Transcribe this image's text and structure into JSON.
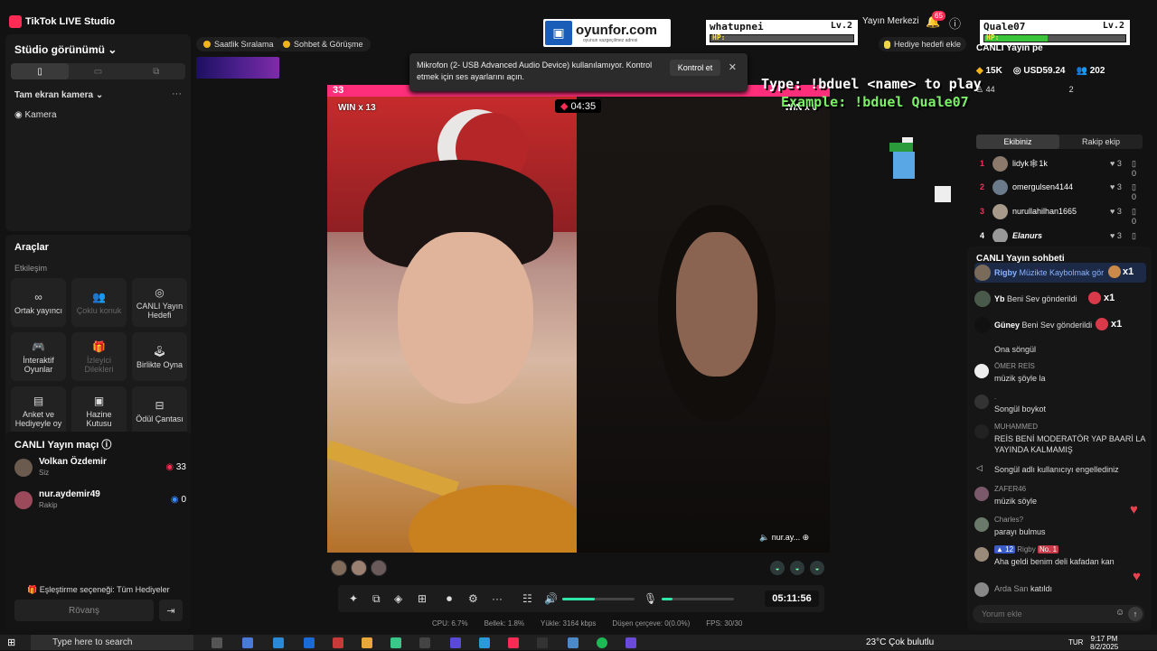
{
  "app": {
    "title": "TikTok LIVE Studio"
  },
  "left": {
    "studio_view_label": "Stüdio görünümü",
    "view_modes": [
      "portrait",
      "landscape",
      "portrait-alt"
    ],
    "scene_label": "Tam ekran kamera",
    "camera_label": "Kamera",
    "tools_title": "Araçlar",
    "interaction_group": "Etkileşim",
    "tools": [
      {
        "label": "Ortak yayıncı",
        "icon": "link-icon",
        "enabled": true
      },
      {
        "label": "Çoklu konuk",
        "icon": "people-icon",
        "enabled": false
      },
      {
        "label": "CANLI Yayın Hedefi",
        "icon": "target-icon",
        "enabled": true
      },
      {
        "label": "İnteraktif Oyunlar",
        "icon": "gamepad-icon",
        "enabled": true
      },
      {
        "label": "İzleyici Dilekleri",
        "icon": "gift-icon",
        "enabled": false
      },
      {
        "label": "Birlikte Oyna",
        "icon": "joystick-icon",
        "enabled": true
      },
      {
        "label": "Anket ve Hediyeyle oy",
        "icon": "poll-icon",
        "enabled": true
      },
      {
        "label": "Hazine Kutusu",
        "icon": "chest-icon",
        "enabled": true
      },
      {
        "label": "Ödül Çantası",
        "icon": "bag-icon",
        "enabled": true
      }
    ],
    "match_title": "CANLI Yayın maçı",
    "match_rows": [
      {
        "name": "Volkan Özdemir",
        "role": "Siz",
        "score": "33"
      },
      {
        "name": "nur.aydemir49",
        "role": "Rakip",
        "score": "0"
      }
    ],
    "pairing_label": "Eşleştirme seçeneği: Tüm Hediyeler",
    "rematch_label": "Rövanş"
  },
  "top_chips": [
    {
      "label": "Saatlik Sıralama"
    },
    {
      "label": "Sohbet & Görüşme"
    }
  ],
  "toast": {
    "message": "Mikrofon (2- USB Advanced Audio Device) kullanılamıyor. Kontrol etmek için ses ayarlarını açın.",
    "action": "Kontrol et"
  },
  "overlay": {
    "brand": "oyunfor.com",
    "brand_sub": "oyunun vazgeçilmez adresi",
    "player1": {
      "name": "whatupnei",
      "level": "Lv.2",
      "hp_label": "HP:",
      "hp": 0.0
    },
    "player2": {
      "name": "Quale07",
      "level": "Lv.2",
      "hp_label": "HP:",
      "hp": 0.45
    },
    "type_line": "Type: !bduel <name> to play",
    "example_line": "Example: !bduel Quale07"
  },
  "stage": {
    "score_left": "33",
    "timer": "04:35",
    "win_left": "WIN x 13",
    "win_right": "WIN x 0",
    "opponent_name": "nur.ay..."
  },
  "controls": {
    "duration": "05:11:56",
    "volume": 0.45,
    "mic_level": 0.15
  },
  "stats": [
    "CPU: 6.7%",
    "Bellek: 1.8%",
    "Yükle: 3164 kbps",
    "Düşen çerçeve: 0(0.0%)",
    "FPS: 30/30"
  ],
  "top_right": {
    "broadcast_center": "Yayın Merkezi",
    "notifications": "65",
    "gift_goal": "Hediye hedefi ekle"
  },
  "right": {
    "live_label": "CANLI Yayın pe",
    "followers": "15K",
    "earnings": "USD59.24",
    "viewers": "202",
    "likes": "44",
    "likes_b": "2",
    "tabs": [
      "Ekibiniz",
      "Rakip ekip"
    ],
    "team": [
      {
        "rank": "1",
        "name": "lidyk🕸1k",
        "likes": "3",
        "comments": "0"
      },
      {
        "rank": "2",
        "name": "omergulsen4144",
        "likes": "3",
        "comments": "0"
      },
      {
        "rank": "3",
        "name": "nurullahilhan1665",
        "likes": "3",
        "comments": "0"
      },
      {
        "rank": "4",
        "name": "Elanurs",
        "likes": "3",
        "comments": "0"
      }
    ],
    "chat_title": "CANLI Yayın sohbeti",
    "gifts": [
      {
        "user": "Rigby",
        "text": "Müzikte Kaybolmak gör",
        "count": "x1"
      },
      {
        "user": "Yb",
        "text": "Beni Sev gönderildi",
        "count": "x1"
      },
      {
        "user": "Güney",
        "text": "Beni Sev gönderildi",
        "count": "x1"
      }
    ],
    "messages": [
      {
        "user": "",
        "text": "Ona söngül"
      },
      {
        "user": "ÖMER REİS",
        "text": "müzik şöyle la"
      },
      {
        "user": ".",
        "text": "Songül boykot"
      },
      {
        "user": "MUHAMMED",
        "text": "REİS BENİ MODERATÖR YAP BAARİ LA YAYINDA KALMAMIŞ"
      },
      {
        "user": "",
        "text": "Songül adlı kullanıcıyı engellediniz"
      },
      {
        "user": "ZAFER46",
        "text": "müzik söyle"
      },
      {
        "user": "Charles?",
        "text": "parayı bulmus"
      },
      {
        "user": "Rigby",
        "badge_level": "12",
        "badge_rank": "No. 1",
        "text": "Aha geldi benim deli kafadan kan"
      },
      {
        "user": "Arda San",
        "text": "katıldı"
      }
    ],
    "chat_placeholder": "Yorum ekle"
  },
  "taskbar": {
    "search_placeholder": "Type here to search",
    "weather": "23°C  Çok bulutlu",
    "lang": "TUR",
    "time": "9:17 PM",
    "date": "8/2/2025"
  }
}
